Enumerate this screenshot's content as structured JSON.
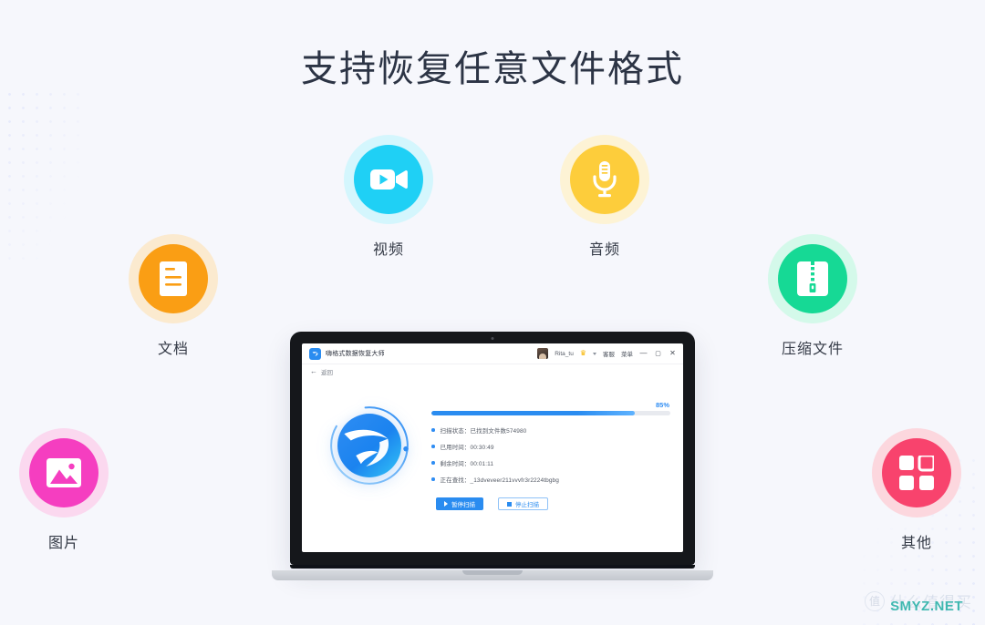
{
  "page": {
    "title": "支持恢复任意文件格式",
    "background_color": "#f6f7fc"
  },
  "categories": [
    {
      "id": "video",
      "label": "视频",
      "icon": "video-camera-icon",
      "disc_color": "#1fd0f5",
      "ring_color": "#d4f6fd"
    },
    {
      "id": "audio",
      "label": "音频",
      "icon": "microphone-icon",
      "disc_color": "#fdcd3b",
      "ring_color": "#fdf3d5"
    },
    {
      "id": "document",
      "label": "文档",
      "icon": "document-icon",
      "disc_color": "#fa9e14",
      "ring_color": "#fbeacf"
    },
    {
      "id": "archive",
      "label": "压缩文件",
      "icon": "zip-archive-icon",
      "disc_color": "#16d995",
      "ring_color": "#d4f9ea"
    },
    {
      "id": "image",
      "label": "图片",
      "icon": "picture-icon",
      "disc_color": "#f53ec0",
      "ring_color": "#fbd8ef"
    },
    {
      "id": "other",
      "label": "其他",
      "icon": "grid-squares-icon",
      "disc_color": "#f8436d",
      "ring_color": "#fcd7de"
    }
  ],
  "app": {
    "titlebar": {
      "brand_name": "嗨格式数据恢复大师",
      "brand_mark": "d-logo-icon",
      "username": "Rita_tu",
      "vip_badge": "crown-icon",
      "dropdown": "caret-down-icon",
      "links": [
        "客服",
        "菜单"
      ],
      "window_controls": {
        "minimize": "—",
        "maximize": "▢",
        "close": "✕"
      }
    },
    "subbar": {
      "back_label": "返回",
      "back_icon": "arrow-left-icon"
    },
    "scan": {
      "progress_percent": "85%",
      "progress_value": 85,
      "logo": "d-brand-logo",
      "status_lines": [
        "扫描状态：已找到文件数574980",
        "已用时间：00:30:49",
        "剩余时间：00:01:11",
        "正在查找：_13dveveer211vvvfr3r2224tbgbg"
      ],
      "buttons": [
        {
          "id": "pause-scan",
          "label": "暂停扫描",
          "icon": "play-icon",
          "style": "primary"
        },
        {
          "id": "stop-scan",
          "label": "停止扫描",
          "icon": "stop-icon",
          "style": "ghost"
        }
      ]
    },
    "accent_color": "#2a8cf0"
  },
  "watermark": {
    "badge": "值",
    "brand": "什么值得买",
    "site": "SMYZ.NET",
    "site_color": "#3fb8b0"
  }
}
